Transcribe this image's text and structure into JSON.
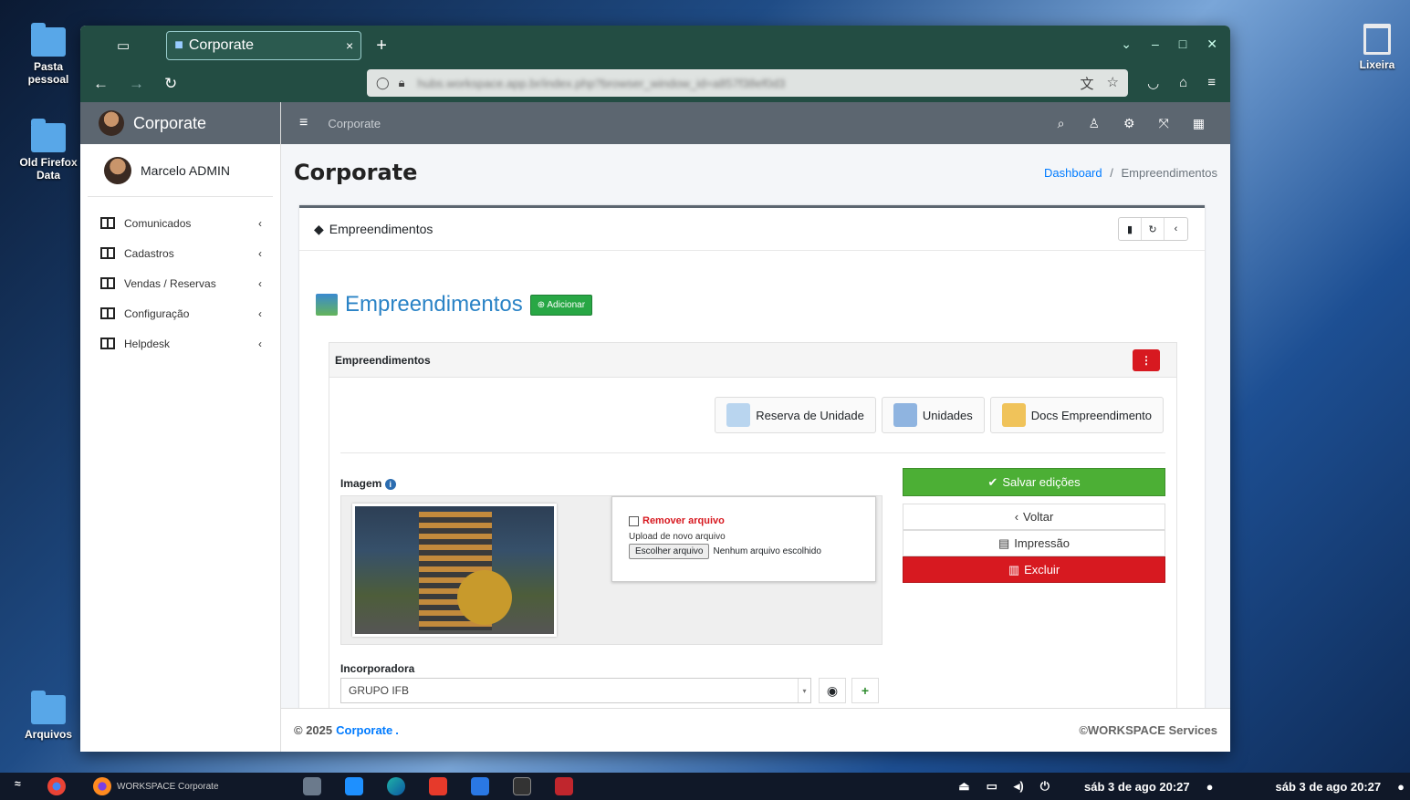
{
  "desktop": {
    "icons": [
      "Pasta pessoal",
      "Old Firefox Data",
      "Arquivos"
    ],
    "trash_label": "Lixeira"
  },
  "browser": {
    "tab_title": "Corporate",
    "tab_close": "×",
    "new_tab": "+",
    "url": "hubs.workspace.app.br/index.php?browser_window_id=a857f38ef0d3"
  },
  "app": {
    "brand": "Corporate",
    "user_name": "Marcelo ADMIN",
    "topnav_title": "Corporate",
    "menu": [
      {
        "label": "Comunicados"
      },
      {
        "label": "Cadastros"
      },
      {
        "label": "Vendas / Reservas"
      },
      {
        "label": "Configuração"
      },
      {
        "label": "Helpdesk"
      }
    ],
    "page_title": "Corporate",
    "breadcrumb": {
      "home": "Dashboard",
      "sep": "/",
      "current": "Empreendimentos"
    },
    "card_title": "Empreendimentos",
    "section_title": "Empreendimentos",
    "add_button": "Adicionar",
    "panel_title": "Empreendimentos",
    "buttons": {
      "reserva": "Reserva de Unidade",
      "unidades": "Unidades",
      "docs": "Docs Empreendimento"
    },
    "image_label": "Imagem",
    "remove_file": "Remover arquivo",
    "upload_label": "Upload de novo arquivo",
    "choose_file": "Escolher arquivo",
    "no_file": "Nenhum arquivo escolhido",
    "save": "Salvar edições",
    "back": "Voltar",
    "print": "Impressão",
    "delete": "Excluir",
    "incorporadora_label": "Incorporadora",
    "incorporadora_value": "GRUPO IFB",
    "footer_left": "© 2025",
    "footer_brand": "Corporate",
    "footer_dot": ".",
    "footer_right": "©WORKSPACE Services"
  },
  "taskbar": {
    "firefox_label": "WORKSPACE Corporate",
    "clock1": "sáb 3 de ago  20:27",
    "clock2": "sáb 3 de ago  20:27"
  }
}
